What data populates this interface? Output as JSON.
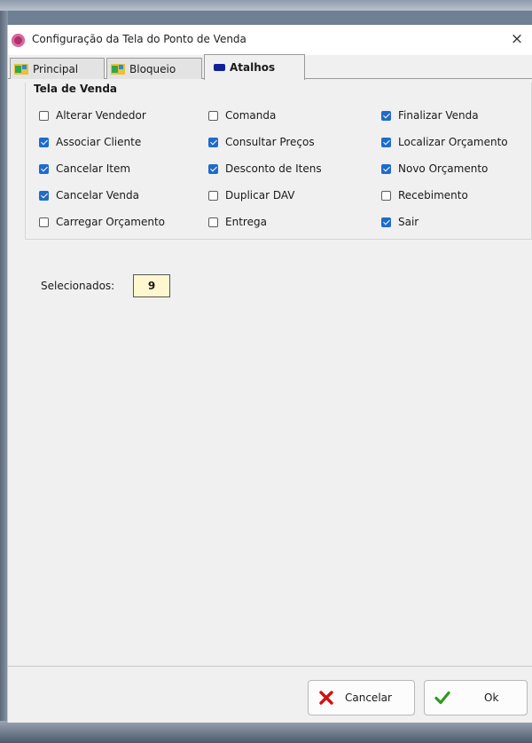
{
  "window": {
    "title": "Configuração da Tela do Ponto de Venda",
    "close_glyph": "×"
  },
  "tabs": [
    {
      "label": "Principal",
      "icon": "map-icon",
      "active": false
    },
    {
      "label": "Bloqueio",
      "icon": "map-icon",
      "active": false
    },
    {
      "label": "Atalhos",
      "icon": "key-icon",
      "active": true
    }
  ],
  "group": {
    "title": "Tela de Venda",
    "options": [
      {
        "label": "Alterar Vendedor",
        "checked": false
      },
      {
        "label": "Associar Cliente",
        "checked": true
      },
      {
        "label": "Cancelar Item",
        "checked": true
      },
      {
        "label": "Cancelar Venda",
        "checked": true
      },
      {
        "label": "Carregar Orçamento",
        "checked": false
      },
      {
        "label": "Comanda",
        "checked": false
      },
      {
        "label": "Consultar Preços",
        "checked": true
      },
      {
        "label": "Desconto de Itens",
        "checked": true
      },
      {
        "label": "Duplicar DAV",
        "checked": false
      },
      {
        "label": "Entrega",
        "checked": false
      },
      {
        "label": "Finalizar Venda",
        "checked": true
      },
      {
        "label": "Localizar Orçamento",
        "checked": true
      },
      {
        "label": "Novo Orçamento",
        "checked": true
      },
      {
        "label": "Recebimento",
        "checked": false
      },
      {
        "label": "Sair",
        "checked": true
      }
    ]
  },
  "selected": {
    "label": "Selecionados:",
    "count": "9"
  },
  "buttons": {
    "cancel_label": "Cancelar",
    "ok_label": "Ok"
  },
  "colors": {
    "checkbox_accent": "#1f6bcb",
    "cancel_icon": "#d01010",
    "ok_icon": "#2e9a1e",
    "count_field": "#fff7d0"
  }
}
